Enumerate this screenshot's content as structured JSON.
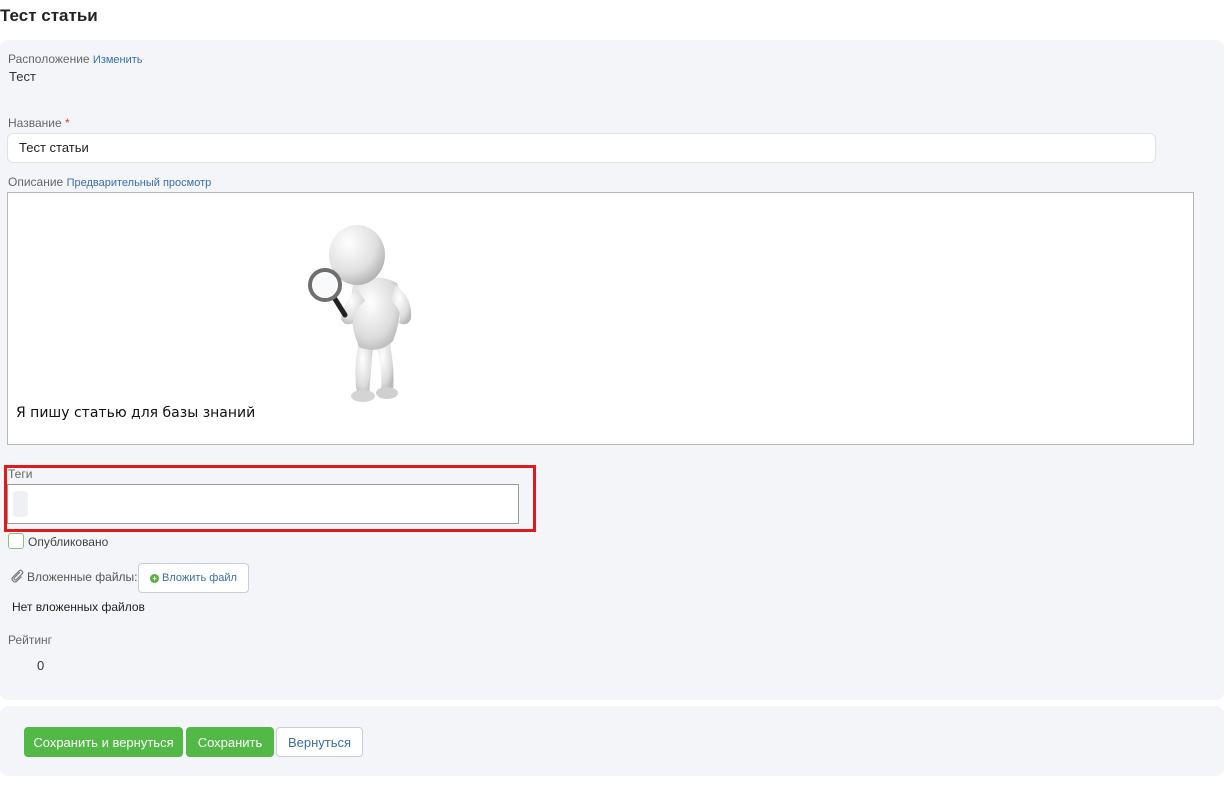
{
  "page": {
    "title": "Тест статьи"
  },
  "location": {
    "label": "Расположение",
    "change_link": "Изменить",
    "value": "Тест"
  },
  "name_field": {
    "label": "Название",
    "required_mark": "*",
    "value": "Тест статьи"
  },
  "description": {
    "label": "Описание",
    "preview_link": "Предварительный просмотр",
    "content_text": "Я пишу статью для базы знаний",
    "image": "figure-with-magnifying-glass"
  },
  "tags": {
    "label": "Теги",
    "value": ""
  },
  "published": {
    "label": "Опубликовано",
    "checked": false
  },
  "attachments": {
    "label": "Вложенные файлы:",
    "icon": "paperclip-icon",
    "attach_button": "Вложить файл",
    "empty_text": "Нет вложенных файлов"
  },
  "rating": {
    "label": "Рейтинг",
    "value": "0"
  },
  "actions": {
    "save_return": "Сохранить и вернуться",
    "save": "Сохранить",
    "back": "Вернуться"
  },
  "colors": {
    "accent_green": "#52b946",
    "link_blue": "#3a6ea8",
    "highlight_red": "#e0191d",
    "panel_bg": "#f3f5f9"
  }
}
